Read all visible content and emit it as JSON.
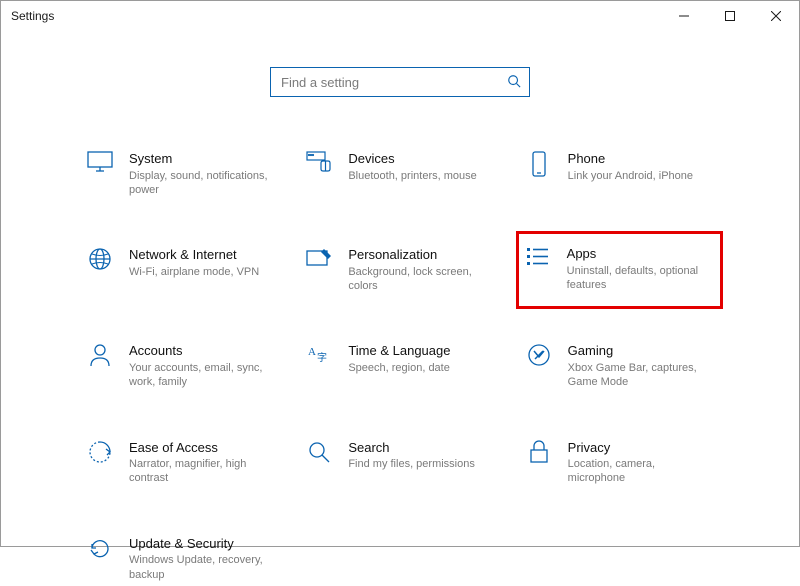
{
  "window": {
    "title": "Settings"
  },
  "search": {
    "placeholder": "Find a setting"
  },
  "cards": {
    "system": {
      "title": "System",
      "sub": "Display, sound, notifications, power"
    },
    "devices": {
      "title": "Devices",
      "sub": "Bluetooth, printers, mouse"
    },
    "phone": {
      "title": "Phone",
      "sub": "Link your Android, iPhone"
    },
    "network": {
      "title": "Network & Internet",
      "sub": "Wi-Fi, airplane mode, VPN"
    },
    "personalization": {
      "title": "Personalization",
      "sub": "Background, lock screen, colors"
    },
    "apps": {
      "title": "Apps",
      "sub": "Uninstall, defaults, optional features"
    },
    "accounts": {
      "title": "Accounts",
      "sub": "Your accounts, email, sync, work, family"
    },
    "time": {
      "title": "Time & Language",
      "sub": "Speech, region, date"
    },
    "gaming": {
      "title": "Gaming",
      "sub": "Xbox Game Bar, captures, Game Mode"
    },
    "ease": {
      "title": "Ease of Access",
      "sub": "Narrator, magnifier, high contrast"
    },
    "searchcard": {
      "title": "Search",
      "sub": "Find my files, permissions"
    },
    "privacy": {
      "title": "Privacy",
      "sub": "Location, camera, microphone"
    },
    "update": {
      "title": "Update & Security",
      "sub": "Windows Update, recovery, backup"
    }
  }
}
